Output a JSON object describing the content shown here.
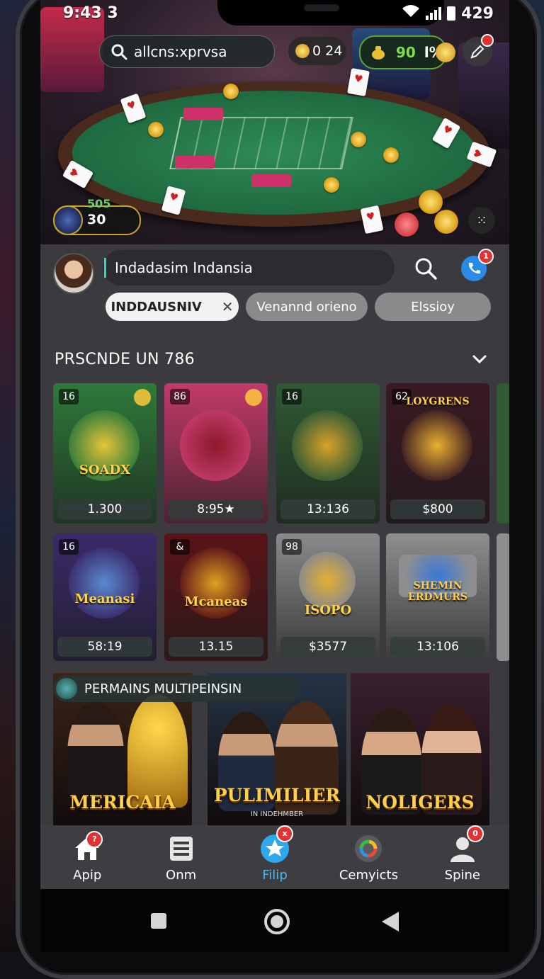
{
  "status_bar": {
    "time": "9:43 3",
    "battery": "429"
  },
  "top_bar": {
    "search_text": "allcns:xprvsa",
    "coins": "0 24",
    "gold_value": "90",
    "gold_suffix": "l%"
  },
  "player": {
    "level_top": "505",
    "level_value": "30"
  },
  "profile": {
    "name_value": "Indadasim Indansia",
    "notification_count": "1"
  },
  "filters": [
    {
      "label": "INDDAUSNIV",
      "active": true
    },
    {
      "label": "Venannd orieno",
      "active": false
    },
    {
      "label": "Elssioy",
      "active": false
    }
  ],
  "section": {
    "title": "PRSCNDE UN 786"
  },
  "games": [
    {
      "tag": "16",
      "price": "1.300",
      "word": "SOADX",
      "color": "#2e7a3a",
      "accent": "#e6c43a"
    },
    {
      "tag": "86",
      "price": "8:95★",
      "word": "",
      "color": "#c23a6a",
      "accent": "#8a1a2a"
    },
    {
      "tag": "16",
      "price": "13:136",
      "word": "",
      "color": "#2f5a34",
      "accent": "#d8a12a"
    },
    {
      "tag": "62",
      "price": "$800",
      "word": "LOYGRENS",
      "color": "#3a1a22",
      "accent": "#e8b030"
    },
    {
      "tag": "16",
      "price": "58:19",
      "word": "Meanasi",
      "color": "#3a2a6a",
      "accent": "#5a8ad0"
    },
    {
      "tag": "&",
      "price": "13.15",
      "word": "Mcaneas",
      "color": "#5a1418",
      "accent": "#e0a020"
    },
    {
      "tag": "98",
      "price": "$3577",
      "word": "ISOPO",
      "color": "#8a8a8c",
      "accent": "#e4b030"
    },
    {
      "tag": "",
      "price": "13:106",
      "word": "SHEMIN ERDMURS",
      "color": "#8e8e90",
      "accent": "#3a78d8"
    }
  ],
  "promo": {
    "title": "PERMAINS MULTIPEINSIN"
  },
  "banners": [
    {
      "label": "MERICAIA",
      "bg": "#3a2416"
    },
    {
      "label": "PULIMILIER",
      "sub": "IN INDEHMBER",
      "bg": "#243446"
    },
    {
      "label": "NOLIGERS",
      "bg": "#3a2030"
    }
  ],
  "nav": [
    {
      "label": "Apip",
      "icon": "home-icon",
      "badge": "?"
    },
    {
      "label": "Onm",
      "icon": "list-icon",
      "badge": ""
    },
    {
      "label": "Filip",
      "icon": "star-icon",
      "badge": "x",
      "active": true
    },
    {
      "label": "Cemyicts",
      "icon": "google-icon",
      "badge": ""
    },
    {
      "label": "Spine",
      "icon": "person-icon",
      "badge": "0"
    }
  ],
  "colors": {
    "accent_green": "#7be04a",
    "accent_blue": "#4fb8f0",
    "badge_red": "#e23232"
  }
}
